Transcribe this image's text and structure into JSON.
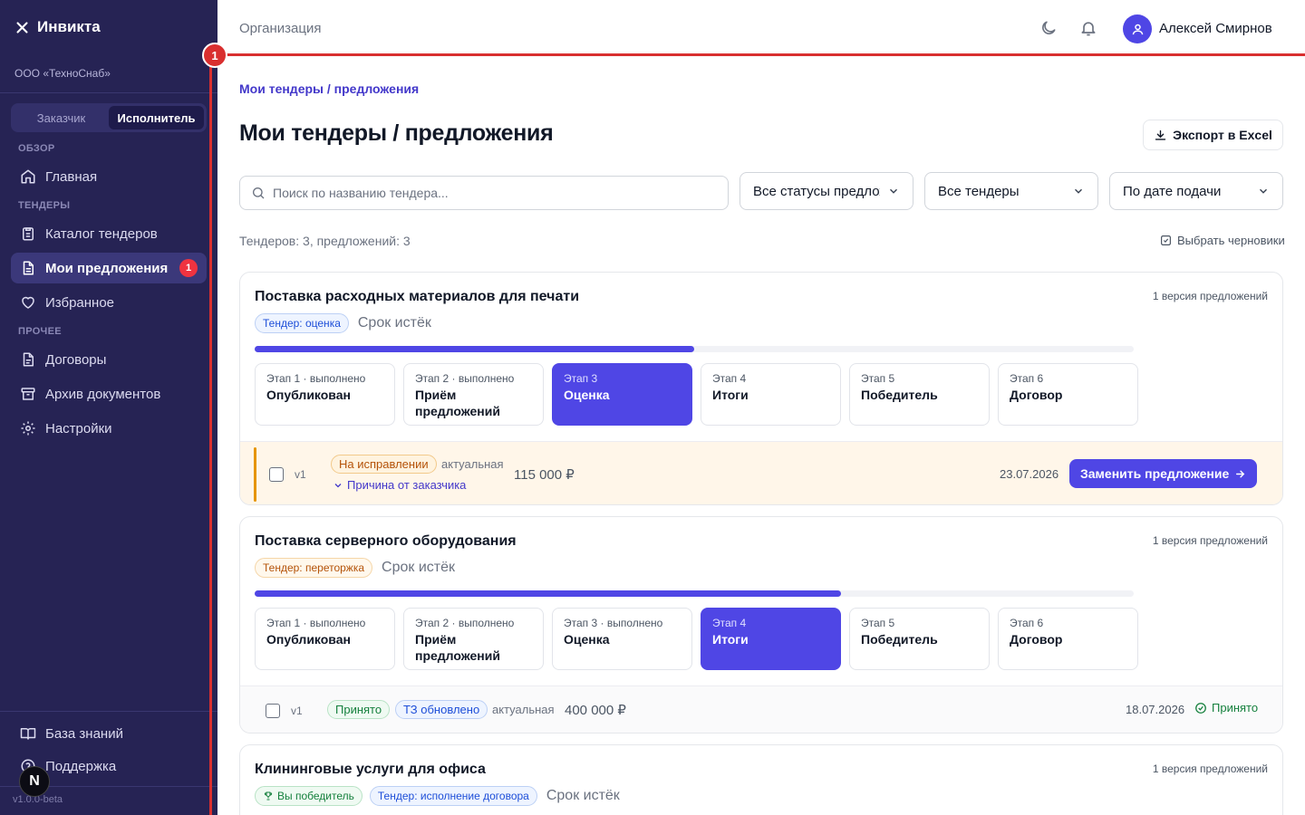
{
  "app": {
    "name": "Инвикта",
    "org": "ООО «ТехноСнаб»",
    "version": "v1.0.0-beta",
    "fab_letter": "N"
  },
  "roles": {
    "customer": "Заказчик",
    "contractor": "Исполнитель"
  },
  "sidebar": {
    "sections": {
      "overview": "Обзор",
      "tenders": "Тендеры",
      "other": "Прочее"
    },
    "items": {
      "home": "Главная",
      "catalog": "Каталог тендеров",
      "my_offers": "Мои предложения",
      "my_offers_badge": "1",
      "favorites": "Избранное",
      "contracts": "Договоры",
      "archive": "Архив документов",
      "settings": "Настройки"
    },
    "bottom": {
      "knowledge": "База знаний",
      "support": "Поддержка"
    }
  },
  "header": {
    "org_link": "Организация",
    "user_name": "Алексей Смирнов"
  },
  "highlight": {
    "marker": "1",
    "color": "#d92f2f"
  },
  "page": {
    "breadcrumb": "Мои тендеры / предложения",
    "title": "Мои тендеры / предложения",
    "export_label": "Экспорт в Excel",
    "search_placeholder": "Поиск по названию тендера...",
    "filter_status": "Все статусы предложений",
    "filter_tenders": "Все тендеры",
    "sort": "По дате подачи",
    "counts": "Тендеров: 3, предложений: 3",
    "select_drafts": "Выбрать черновики"
  },
  "tenders": [
    {
      "title": "Поставка расходных материалов для печати",
      "versions": "1 версия предложений",
      "tag": "Тендер: оценка",
      "deadline": "Срок истёк",
      "progress": 0.5,
      "stages": [
        {
          "label": "Этап 1 · выполнено",
          "name": "Опубликован"
        },
        {
          "label": "Этап 2 · выполнено",
          "name": "Приём предложений"
        },
        {
          "label": "Этап 3",
          "name": "Оценка"
        },
        {
          "label": "Этап 4",
          "name": "Итоги"
        },
        {
          "label": "Этап 5",
          "name": "Победитель"
        },
        {
          "label": "Этап 6",
          "name": "Договор"
        }
      ],
      "offer": {
        "version": "v1",
        "status": "На исправлении",
        "actual": "актуальная",
        "price": "115 000 ₽",
        "reason": "Причина от заказчика",
        "date": "23.07.2026",
        "action": "Заменить предложение"
      }
    },
    {
      "title": "Поставка серверного оборудования",
      "versions": "1 версия предложений",
      "tag": "Тендер: переторжка",
      "deadline": "Срок истёк",
      "progress": 0.667,
      "stages": [
        {
          "label": "Этап 1 · выполнено",
          "name": "Опубликован"
        },
        {
          "label": "Этап 2 · выполнено",
          "name": "Приём предложений"
        },
        {
          "label": "Этап 3 · выполнено",
          "name": "Оценка"
        },
        {
          "label": "Этап 4",
          "name": "Итоги"
        },
        {
          "label": "Этап 5",
          "name": "Победитель"
        },
        {
          "label": "Этап 6",
          "name": "Договор"
        }
      ],
      "offer": {
        "version": "v1",
        "status": "Принято",
        "tz": "ТЗ обновлено",
        "actual": "актуальная",
        "price": "400 000 ₽",
        "date": "18.07.2026",
        "result": "Принято"
      }
    },
    {
      "title": "Клининговые услуги для офиса",
      "versions": "1 версия предложений",
      "winner_tag": "Вы победитель",
      "tag": "Тендер: исполнение договора",
      "deadline": "Срок истёк"
    }
  ],
  "colors": {
    "accent": "#4f46e5",
    "sidebar": "#262354",
    "warn": "#e69500",
    "success": "#15803d"
  }
}
